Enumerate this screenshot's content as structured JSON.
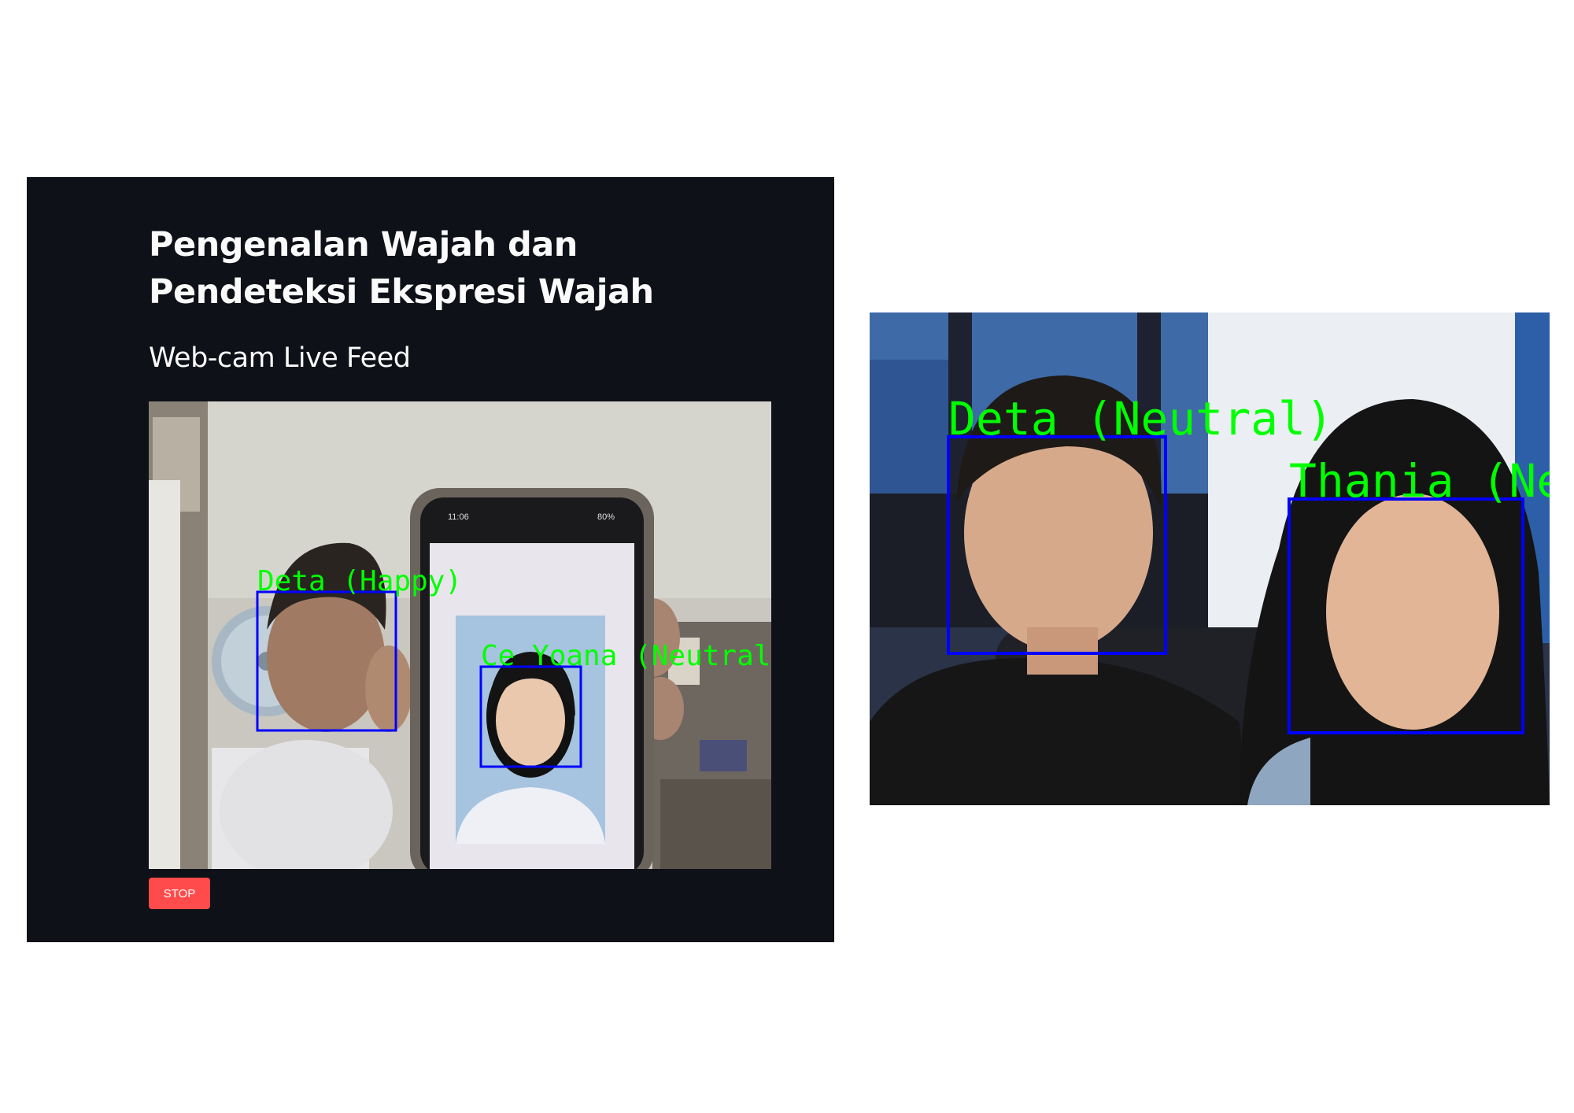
{
  "app": {
    "title": "Pengenalan Wajah dan Pendeteksi Ekspresi Wajah",
    "subtitle": "Web-cam Live Feed",
    "stop_label": "STOP",
    "colors": {
      "background": "#0e1117",
      "text": "#fafafa",
      "stop_button": "#ff4b4b"
    }
  },
  "webcam_feed": {
    "detections": [
      {
        "label": "Deta (Happy)"
      },
      {
        "label": "Ce Yoana (Neutral)"
      }
    ],
    "phone_status": {
      "time": "11:06",
      "battery": "80%"
    }
  },
  "photo_feed": {
    "detections": [
      {
        "label": "Deta (Neutral)"
      },
      {
        "label": "Thania (Neu"
      }
    ]
  },
  "detection_colors": {
    "box": "#0000ff",
    "label": "#00ff00"
  },
  "icons": [
    "phone-icon",
    "fan-icon"
  ]
}
